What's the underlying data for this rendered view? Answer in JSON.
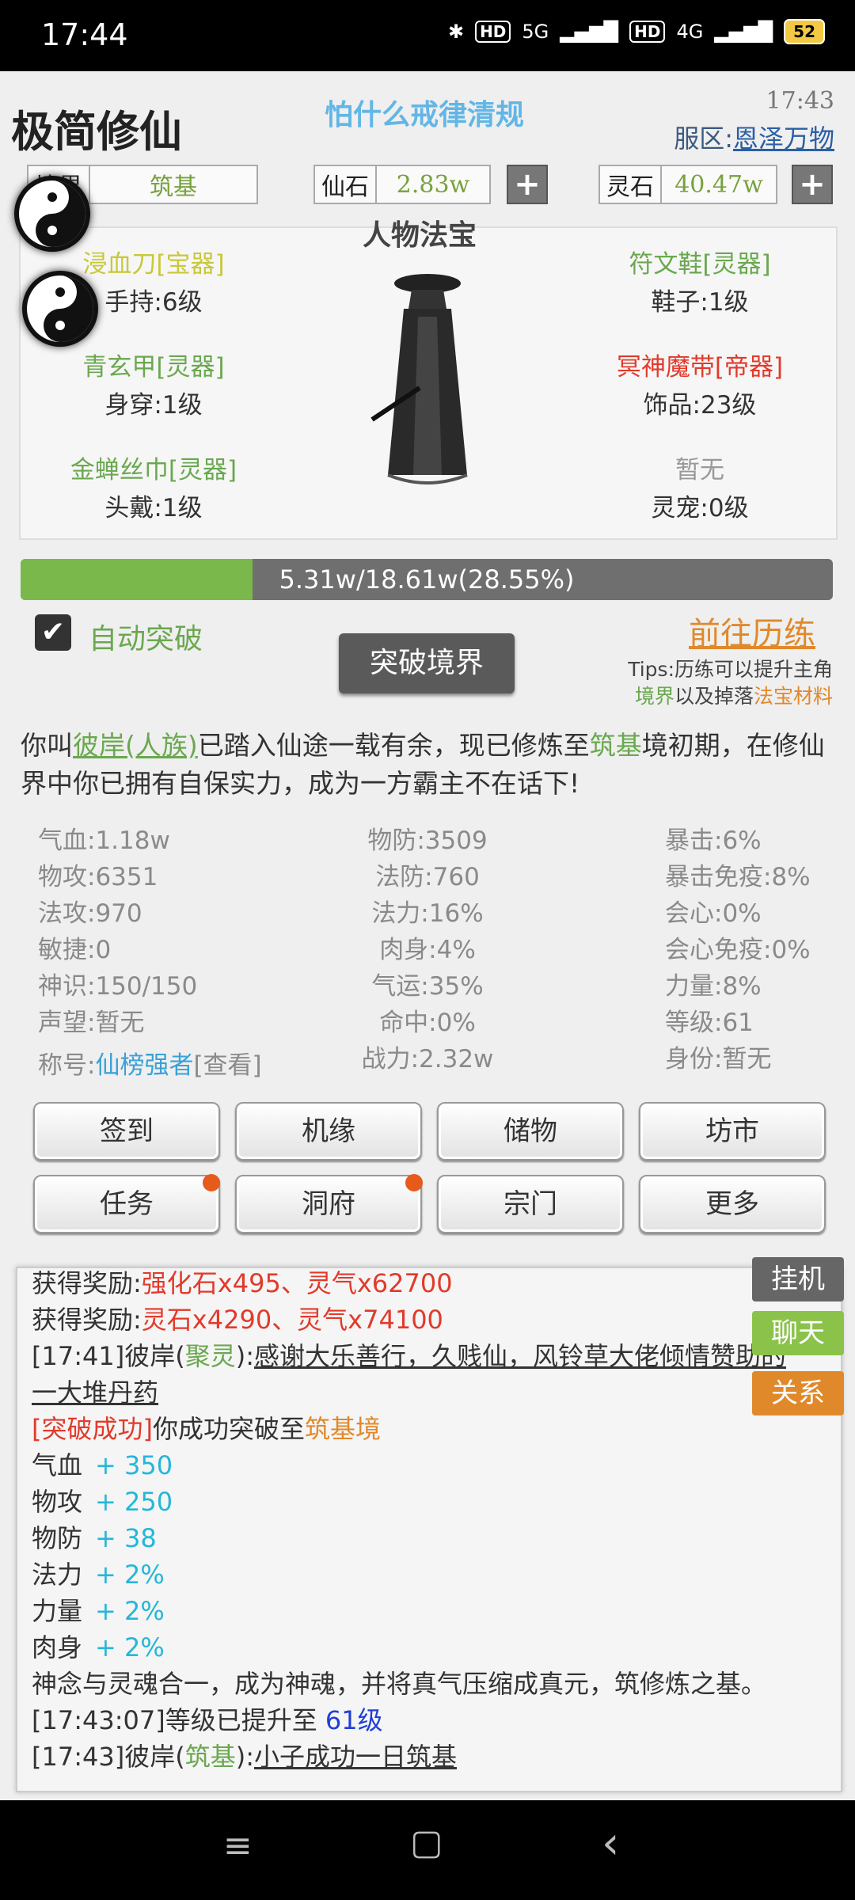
{
  "status": {
    "time": "17:44",
    "network1": "5G",
    "network2": "4G",
    "battery": "52"
  },
  "header": {
    "title": "极简修仙",
    "motto": "怕什么戒律清规",
    "time": "17:43",
    "server_label": "服区:",
    "server_name": "恩泽万物"
  },
  "resources": {
    "realm_label": "境界",
    "realm_value": "筑基",
    "xianshi_label": "仙石",
    "xianshi_value": "2.83w",
    "lingshi_label": "灵石",
    "lingshi_value": "40.47w",
    "plus": "+"
  },
  "equipment": {
    "title": "人物法宝",
    "items": [
      {
        "name": "浸血刀[宝器]",
        "slot": "手持:6级",
        "color": "#c8c83a"
      },
      {
        "name": "符文鞋[灵器]",
        "slot": "鞋子:1级",
        "color": "#6aa84f"
      },
      {
        "name": "青玄甲[灵器]",
        "slot": "身穿:1级",
        "color": "#6aa84f"
      },
      {
        "name": "冥神魔带[帝器]",
        "slot": "饰品:23级",
        "color": "#e23a2b"
      },
      {
        "name": "金蝉丝巾[灵器]",
        "slot": "头戴:1级",
        "color": "#6aa84f"
      },
      {
        "name": "暂无",
        "slot": "灵宠:0级",
        "color": "#999999"
      }
    ]
  },
  "progress": {
    "text": "5.31w/18.61w(28.55%)",
    "fraction": 0.2855
  },
  "breakthrough": {
    "auto_label": "自动突破",
    "button": "突破境界",
    "goto": "前往历练",
    "tips_prefix": "Tips:历练可以提升主角",
    "tips_a": "境界",
    "tips_mid": "以及掉落",
    "tips_b": "法宝材料"
  },
  "story": {
    "p1": "你叫",
    "name": "彼岸(人族)",
    "p2": "已踏入仙途一载有余，现已修炼至",
    "realm": "筑基",
    "p3": "境初期，在修仙界中你已拥有自保实力，成为一方霸主不在话下!"
  },
  "stats": {
    "col1": [
      "气血:1.18w",
      "物攻:6351",
      "法攻:970",
      "敏捷:0",
      "神识:150/150",
      "声望:暂无"
    ],
    "col2": [
      "物防:3509",
      "法防:760",
      "法力:16%",
      "肉身:4%",
      "气运:35%",
      "命中:0%",
      "战力:2.32w"
    ],
    "col3": [
      "暴击:6%",
      "暴击免疫:8%",
      "会心:0%",
      "会心免疫:0%",
      "力量:8%",
      "等级:61",
      "身份:暂无"
    ],
    "title_label": "称号:",
    "title_value": "仙榜强者",
    "title_view": "[查看]"
  },
  "menu": {
    "row1": [
      "签到",
      "机缘",
      "储物",
      "坊市"
    ],
    "row2": [
      "任务",
      "洞府",
      "宗门",
      "更多"
    ]
  },
  "side_buttons": {
    "idle": "挂机",
    "chat": "聊天",
    "relation": "关系"
  },
  "log": {
    "l0_label": "获得奖励:",
    "l0_value": "强化石x495、灵气x62700",
    "l1_label": "获得奖励:",
    "l1_value": "灵石x4290、灵气x74100",
    "l2_a": "[17:41]彼岸(",
    "l2_b": "聚灵",
    "l2_c": "):",
    "l2_d": "感谢大乐善行，久贱仙，风铃草大佬倾情赞助的",
    "l3": "一大堆丹药",
    "l4_a": "[突破成功]",
    "l4_b": "你成功突破至",
    "l4_c": "筑基境",
    "gains": [
      {
        "k": "气血",
        "v": "+ 350"
      },
      {
        "k": "物攻",
        "v": "+ 250"
      },
      {
        "k": "物防",
        "v": "+ 38"
      },
      {
        "k": "法力",
        "v": "+ 2%"
      },
      {
        "k": "力量",
        "v": "+ 2%"
      },
      {
        "k": "肉身",
        "v": "+ 2%"
      }
    ],
    "l11": "神念与灵魂合一，成为神魂，并将真气压缩成真元，筑修炼之基。",
    "l12_a": "[17:43:07]等级已提升至 ",
    "l12_b": "61级",
    "l13_a": "[17:43]彼岸(",
    "l13_b": "筑基",
    "l13_c": "):",
    "l13_d": "小子成功一日筑基"
  },
  "nav": {
    "menu_icon": "≡",
    "home_icon": "▢",
    "back_icon": "‹"
  }
}
